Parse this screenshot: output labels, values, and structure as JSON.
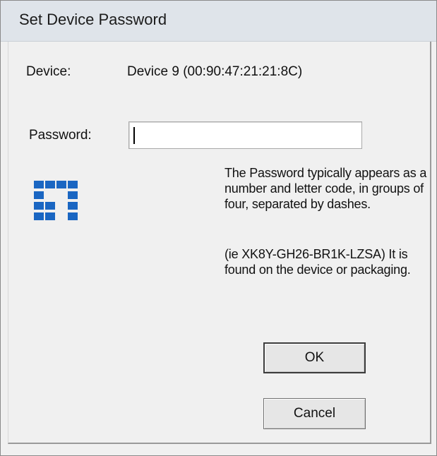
{
  "window": {
    "title": "Set Device Password"
  },
  "device": {
    "label": "Device:",
    "value": "Device 9  (00:90:47:21:21:8C)"
  },
  "password": {
    "label": "Password:",
    "value": "",
    "placeholder": ""
  },
  "logo": {
    "name": "levelone-logo-icon",
    "color": "#1a66c2"
  },
  "help": {
    "paragraph1": "The Password typically appears as a number and letter code, in groups of four, separated by dashes.",
    "paragraph2": "(ie XK8Y-GH26-BR1K-LZSA) It is found on the device or packaging."
  },
  "buttons": {
    "ok_label": "OK",
    "cancel_label": "Cancel"
  },
  "colors": {
    "dialog_bg": "#f0f0f0",
    "titlebar_bg": "#dfe4ea",
    "accent_blue": "#1a66c2"
  }
}
